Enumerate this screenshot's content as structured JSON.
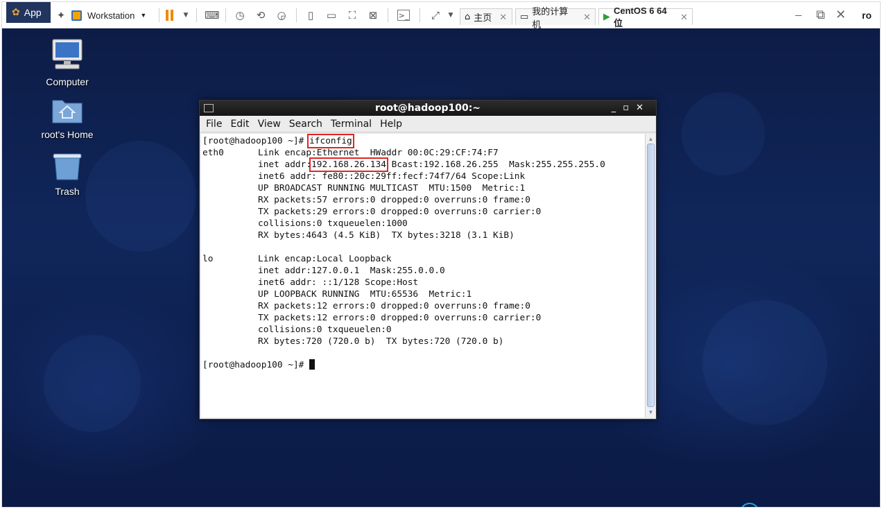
{
  "vm_toolbar": {
    "applications_label": "App",
    "workstation_label": "Workstation",
    "tabs": [
      {
        "label": "主页",
        "active": false
      },
      {
        "label": "我的计算机",
        "active": false
      },
      {
        "label": "CentOS 6 64 位",
        "active": true
      }
    ],
    "right_label": "ro"
  },
  "desktop": {
    "icons": [
      {
        "label": "Computer",
        "icon": "computer-icon"
      },
      {
        "label": "root's Home",
        "icon": "home-folder-icon"
      },
      {
        "label": "Trash",
        "icon": "trash-icon"
      }
    ]
  },
  "terminal": {
    "title": "root@hadoop100:~",
    "menu": [
      "File",
      "Edit",
      "View",
      "Search",
      "Terminal",
      "Help"
    ],
    "prompt": "[root@hadoop100 ~]# ",
    "command": "ifconfig",
    "eth0_label": "eth0",
    "eth0_link": "Link encap:Ethernet  HWaddr 00:0C:29:CF:74:F7",
    "inet_prefix": "inet addr:",
    "inet_ip": "192.168.26.134",
    "inet_suffix": " Bcast:192.168.26.255  Mask:255.255.255.0",
    "eth0_lines": [
      "inet6 addr: fe80::20c:29ff:fecf:74f7/64 Scope:Link",
      "UP BROADCAST RUNNING MULTICAST  MTU:1500  Metric:1",
      "RX packets:57 errors:0 dropped:0 overruns:0 frame:0",
      "TX packets:29 errors:0 dropped:0 overruns:0 carrier:0",
      "collisions:0 txqueuelen:1000",
      "RX bytes:4643 (4.5 KiB)  TX bytes:3218 (3.1 KiB)"
    ],
    "lo_label": "lo",
    "lo_link": "Link encap:Local Loopback",
    "lo_lines": [
      "inet addr:127.0.0.1  Mask:255.0.0.0",
      "inet6 addr: ::1/128 Scope:Host",
      "UP LOOPBACK RUNNING  MTU:65536  Metric:1",
      "RX packets:12 errors:0 dropped:0 overruns:0 frame:0",
      "TX packets:12 errors:0 dropped:0 overruns:0 carrier:0",
      "collisions:0 txqueuelen:0",
      "RX bytes:720 (720.0 b)  TX bytes:720 (720.0 b)"
    ],
    "final_prompt": "[root@hadoop100 ~]# "
  },
  "colors": {
    "highlight": "#e02424",
    "accent": "#23a3e0",
    "pause": "#f08a00"
  }
}
